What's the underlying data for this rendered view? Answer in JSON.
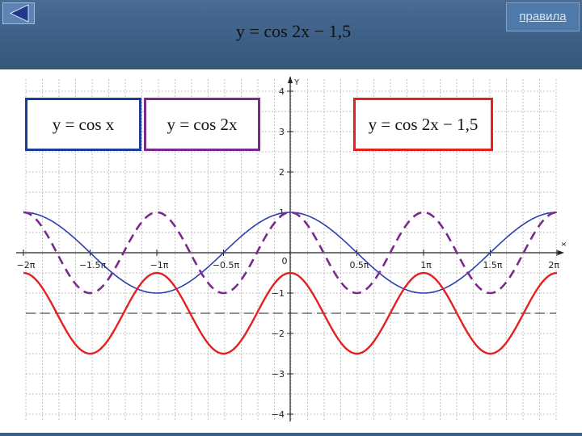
{
  "header": {
    "title": "y = cos 2x − 1,5",
    "rules_label": "правила"
  },
  "colors": {
    "header_bg": "#3d5f85",
    "blue_series": "#2c3fae",
    "purple_series": "#7a2a8c",
    "red_series": "#e52020"
  },
  "icons": {
    "back": "triangle-left-icon"
  },
  "legend": [
    {
      "label": "y = cos x",
      "color": "#1a3d9c"
    },
    {
      "label": "y = cos 2x",
      "color": "#7a2a8c"
    },
    {
      "label": "y = cos 2x − 1,5",
      "color": "#e52020"
    }
  ],
  "chart_data": {
    "type": "line",
    "title": "y = cos 2x − 1,5",
    "xlabel": "x",
    "ylabel": "Y",
    "xlim_pi": [
      -2,
      2
    ],
    "ylim": [
      -4,
      4
    ],
    "grid": true,
    "x_ticks": [
      "−2π",
      "−1.5π",
      "−1π",
      "−0.5π",
      "0",
      "0.5π",
      "1π",
      "1.5π",
      "2π"
    ],
    "y_ticks": [
      "4",
      "3",
      "2",
      "1",
      "−1",
      "−2",
      "−3",
      "−4"
    ],
    "series": [
      {
        "name": "y = cos x",
        "expression": "cos(x)",
        "style": "solid"
      },
      {
        "name": "y = cos 2x",
        "expression": "cos(2x)",
        "style": "dashed"
      },
      {
        "name": "y = cos 2x − 1,5",
        "expression": "cos(2x) - 1.5",
        "style": "solid"
      }
    ],
    "annotations": [
      {
        "type": "hline",
        "y": -1.5,
        "style": "dashed"
      }
    ]
  }
}
